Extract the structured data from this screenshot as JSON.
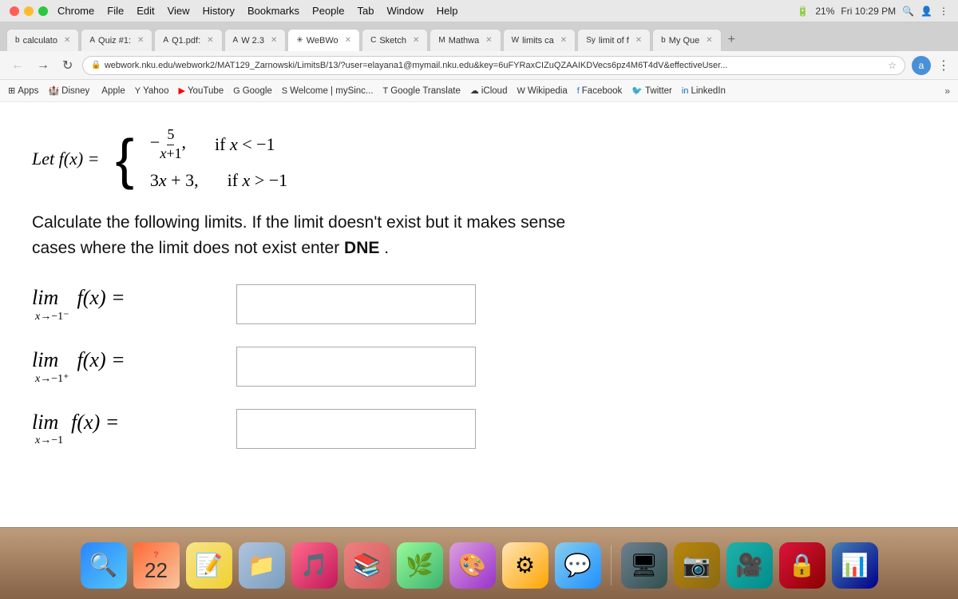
{
  "titlebar": {
    "menus": [
      "Chrome",
      "File",
      "Edit",
      "View",
      "History",
      "Bookmarks",
      "People",
      "Tab",
      "Window",
      "Help"
    ],
    "battery": "21%",
    "time": "Fri 10:29 PM"
  },
  "tabs": [
    {
      "label": "calculato",
      "icon": "b",
      "active": false
    },
    {
      "label": "Quiz #1:",
      "icon": "A",
      "active": false
    },
    {
      "label": "Q1.pdf:",
      "icon": "A",
      "active": false
    },
    {
      "label": "W 2.3",
      "icon": "A",
      "active": false
    },
    {
      "label": "WeBWo",
      "icon": "✳",
      "active": true
    },
    {
      "label": "Sketch",
      "icon": "C",
      "active": false
    },
    {
      "label": "Mathwa",
      "icon": "M",
      "active": false
    },
    {
      "label": "limits ca",
      "icon": "W",
      "active": false
    },
    {
      "label": "limit of f",
      "icon": "Sy",
      "active": false
    },
    {
      "label": "My Que",
      "icon": "b",
      "active": false
    }
  ],
  "navbar": {
    "url": "webwork.nku.edu/webwork2/MAT129_Zarnowski/LimitsB/13/?user=elayana1@mymail.nku.edu&key=6uFYRaxCIZuQZAAIKDVecs6pz4M6T4dV&effectiveUser...",
    "url_short": "webwork.nku.edu/webwork2/MAT129_Zarnowski/LimitsB/13/?user=elayana1@mymail.nku.edu&key=6uFYRaxCIZuQZAAIKDVecs6pz4M6T4dV&effectiveUser..."
  },
  "bookmarks": [
    {
      "label": "Apps",
      "icon": "⊞"
    },
    {
      "label": "Disney",
      "icon": "D"
    },
    {
      "label": "Apple",
      "icon": ""
    },
    {
      "label": "Yahoo",
      "icon": "Y"
    },
    {
      "label": "YouTube",
      "icon": "▶"
    },
    {
      "label": "Google",
      "icon": "G"
    },
    {
      "label": "Welcome | mySinc...",
      "icon": "S"
    },
    {
      "label": "Google Translate",
      "icon": "T"
    },
    {
      "label": "iCloud",
      "icon": "☁"
    },
    {
      "label": "Wikipedia",
      "icon": "W"
    },
    {
      "label": "Facebook",
      "icon": "f"
    },
    {
      "label": "Twitter",
      "icon": "🐦"
    },
    {
      "label": "LinkedIn",
      "icon": "in"
    }
  ],
  "problem": {
    "intro": "Let f(x) =",
    "case1_formula": "−5 / (x+1),",
    "case1_condition": "if x < −1",
    "case2_formula": "3x + 3,",
    "case2_condition": "if x > −1",
    "description_line1": "Calculate the following limits. If the limit doesn't exist but it makes sense",
    "description_line2": "cases where the limit does not exist enter",
    "description_dne": "DNE",
    "description_end": ".",
    "limit1_label": "lim f(x) =",
    "limit1_sub": "x→−1⁻",
    "limit2_label": "lim f(x) =",
    "limit2_sub": "x→−1⁺",
    "limit3_label": "lim f(x) =",
    "limit3_sub": "x→−1"
  },
  "dock": {
    "date_month": "?",
    "date_day": "22"
  }
}
